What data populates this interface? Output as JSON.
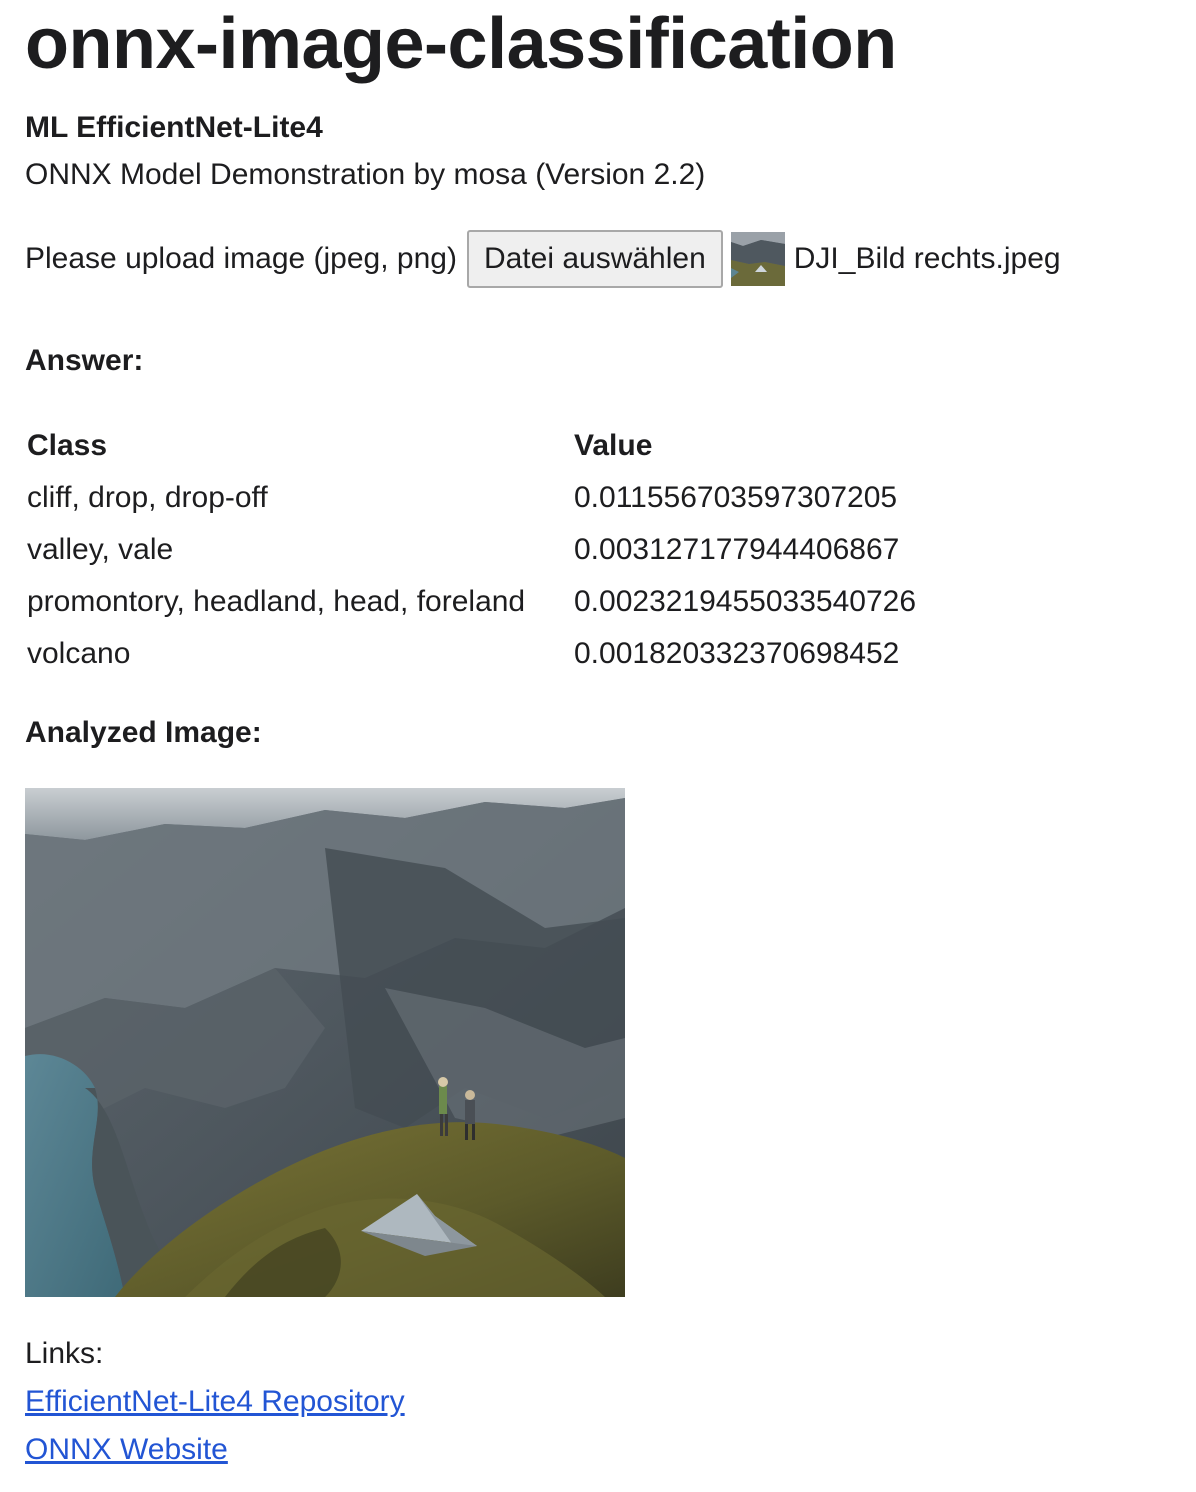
{
  "header": {
    "title": "onnx-image-classification",
    "model_name": "ML EfficientNet-Lite4",
    "subtitle": "ONNX Model Demonstration by mosa (Version 2.2)"
  },
  "upload": {
    "label": "Please upload image (jpeg, png)",
    "button_label": "Datei auswählen",
    "file_name": "DJI_Bild rechts.jpeg"
  },
  "answer": {
    "heading": "Answer:",
    "columns": [
      "Class",
      "Value"
    ],
    "rows": [
      {
        "class": "cliff, drop, drop-off",
        "value": "0.011556703597307205"
      },
      {
        "class": "valley, vale",
        "value": "0.003127177944406867"
      },
      {
        "class": "promontory, headland, head, foreland",
        "value": "0.0023219455033540726"
      },
      {
        "class": "volcano",
        "value": "0.001820332370698452"
      }
    ]
  },
  "analyzed": {
    "heading": "Analyzed Image:"
  },
  "links": {
    "label": "Links:",
    "items": [
      {
        "text": "EfficientNet-Lite4 Repository"
      },
      {
        "text": "ONNX Website"
      }
    ],
    "color": "#2255d4"
  }
}
